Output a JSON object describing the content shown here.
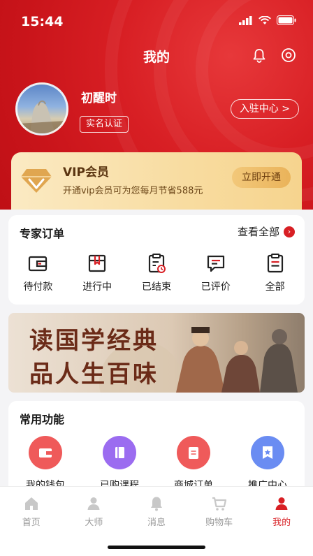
{
  "status_bar": {
    "time": "15:44"
  },
  "header": {
    "title": "我的",
    "username": "初醒时",
    "verify_label": "实名认证",
    "join_label": "入驻中心 >"
  },
  "vip": {
    "title": "VIP会员",
    "description": "开通vip会员可为您每月节省588元",
    "button": "立即开通"
  },
  "orders": {
    "title": "专家订单",
    "view_all": "查看全部",
    "items": [
      {
        "label": "待付款",
        "icon": "wallet-icon"
      },
      {
        "label": "进行中",
        "icon": "book-icon"
      },
      {
        "label": "已结束",
        "icon": "clipboard-clock-icon"
      },
      {
        "label": "已评价",
        "icon": "comment-icon"
      },
      {
        "label": "全部",
        "icon": "clipboard-icon"
      }
    ]
  },
  "banner": {
    "line1": "读国学经典",
    "line2": "品人生百味"
  },
  "functions": {
    "title": "常用功能",
    "items": [
      {
        "label": "我的钱包",
        "icon": "wallet-icon",
        "color": "#ef5a5a"
      },
      {
        "label": "已购课程",
        "icon": "book-icon",
        "color": "#9b6cf0"
      },
      {
        "label": "商城订单",
        "icon": "order-list-icon",
        "color": "#ef5a5a"
      },
      {
        "label": "推广中心",
        "icon": "star-badge-icon",
        "color": "#6a8cf2"
      }
    ]
  },
  "tabbar": {
    "items": [
      {
        "label": "首页",
        "icon": "home-icon",
        "active": false
      },
      {
        "label": "大师",
        "icon": "person-icon",
        "active": false
      },
      {
        "label": "消息",
        "icon": "bell-icon",
        "active": false
      },
      {
        "label": "购物车",
        "icon": "cart-icon",
        "active": false
      },
      {
        "label": "我的",
        "icon": "user-icon",
        "active": true
      }
    ]
  },
  "colors": {
    "brand_red": "#d81f24",
    "vip_gold": "#f6d48e"
  }
}
